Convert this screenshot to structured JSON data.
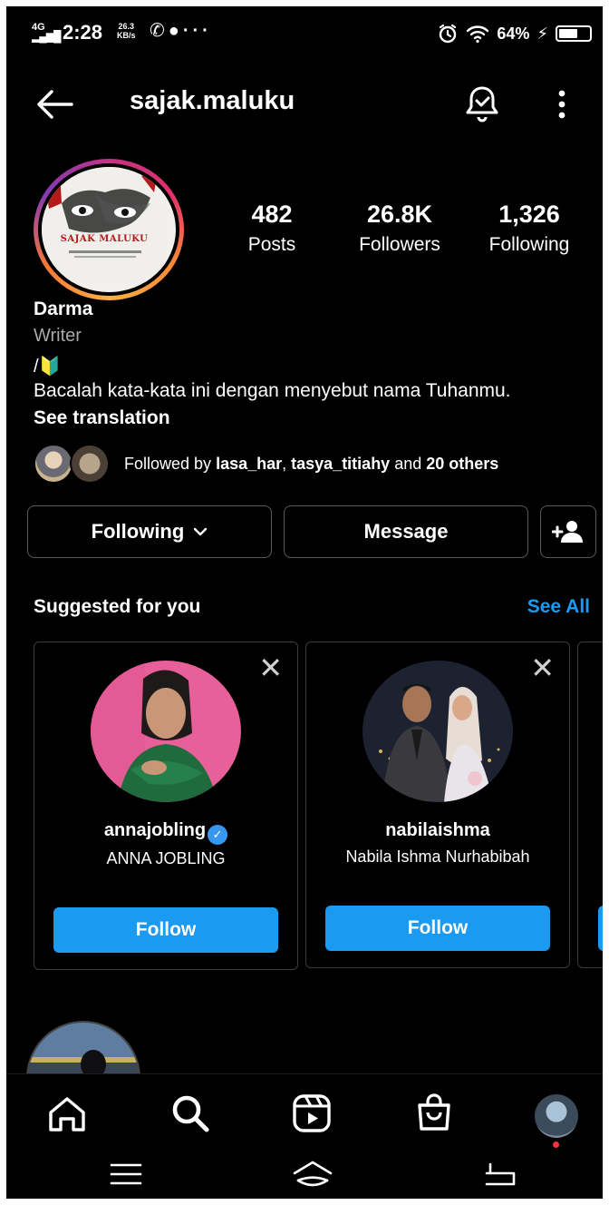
{
  "status_bar": {
    "network": "4G",
    "time": "2:28",
    "speed_value": "26.3",
    "speed_unit": "KB/s",
    "more": "···",
    "battery": "64%",
    "battery_level": 0.64
  },
  "header": {
    "username": "sajak.maluku",
    "back_icon": "arrow-left-icon",
    "bell_icon": "bell-check-icon",
    "menu_icon": "more-vertical-icon"
  },
  "profile": {
    "avatar_text": "SAJAK MALUKU",
    "stats": [
      {
        "value": "482",
        "label": "Posts"
      },
      {
        "value": "26.8K",
        "label": "Followers"
      },
      {
        "value": "1,326",
        "label": "Following"
      }
    ],
    "name": "Darma",
    "category": "Writer",
    "emoji_line": "/🔰",
    "bio": "Bacalah kata-kata ini dengan menyebut nama Tuhanmu.",
    "see_translation": "See translation",
    "followed_by_prefix": "Followed by ",
    "followed_by_user1": "lasa_har",
    "followed_by_sep": ", ",
    "followed_by_user2": "tasya_titiahy",
    "followed_by_and": " and ",
    "followed_by_others": "20 others"
  },
  "actions": {
    "following": "Following",
    "message": "Message"
  },
  "suggested": {
    "title": "Suggested for you",
    "see_all": "See All",
    "cards": [
      {
        "username": "annajobling",
        "full_name": "ANNA JOBLING",
        "verified": true,
        "follow": "Follow"
      },
      {
        "username": "nabilaishma",
        "full_name": "Nabila Ishma Nurhabibah",
        "verified": false,
        "follow": "Follow"
      }
    ]
  },
  "bottom_nav": [
    "home-icon",
    "search-icon",
    "reels-icon",
    "shop-icon",
    "profile-avatar"
  ],
  "colors": {
    "accent": "#1a9af0",
    "background": "#000000",
    "verified": "#3897f0",
    "notification_dot": "#ff3040"
  }
}
